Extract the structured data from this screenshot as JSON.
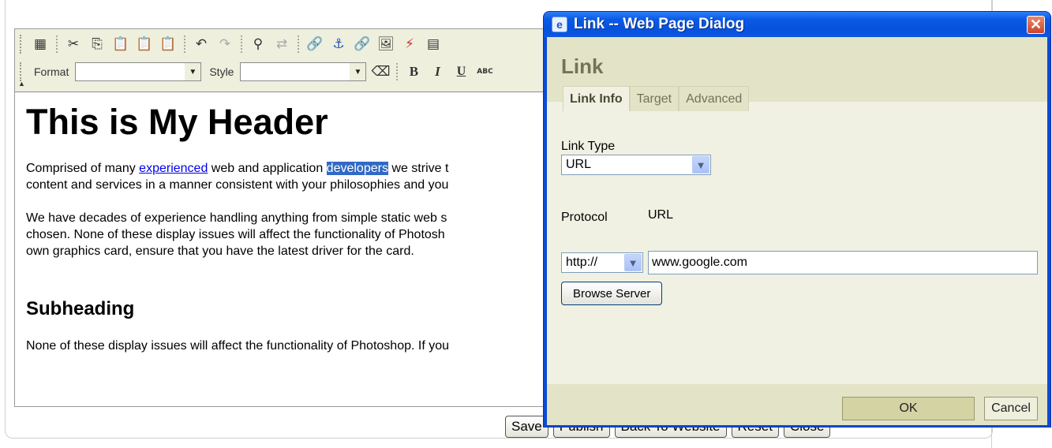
{
  "toolbar": {
    "format_label": "Format",
    "style_label": "Style",
    "format_value": "",
    "style_value": "",
    "abc": "ABC"
  },
  "content": {
    "h1": "This is My Header",
    "p1_before": "Comprised of many ",
    "p1_link": "experienced",
    "p1_mid": " web and application ",
    "p1_selected": "developers",
    "p1_after": " we strive t",
    "p1_line2": "content and services in a manner consistent with your philosophies and you",
    "p2_line1": "We have decades of experience handling anything from simple static web s",
    "p2_line2": "chosen. None of these display issues will affect the functionality of Photosh",
    "p2_line3": "own graphics card, ensure that you have the latest driver for the card.",
    "h2": "Subheading",
    "p3_line1": "None of these display issues will affect the functionality of Photoshop. If you"
  },
  "page_buttons": {
    "save": "Save",
    "publish": "Publish",
    "back": "Back To Website",
    "reset": "Reset",
    "close": "Close"
  },
  "dialog": {
    "title": "Link -- Web Page Dialog",
    "heading": "Link",
    "tabs": [
      "Link Info",
      "Target",
      "Advanced"
    ],
    "link_type_label": "Link Type",
    "link_type_value": "URL",
    "protocol_label": "Protocol",
    "protocol_value": "http://",
    "url_label": "URL",
    "url_value": "www.google.com",
    "browse_label": "Browse Server",
    "ok_label": "OK",
    "cancel_label": "Cancel"
  }
}
